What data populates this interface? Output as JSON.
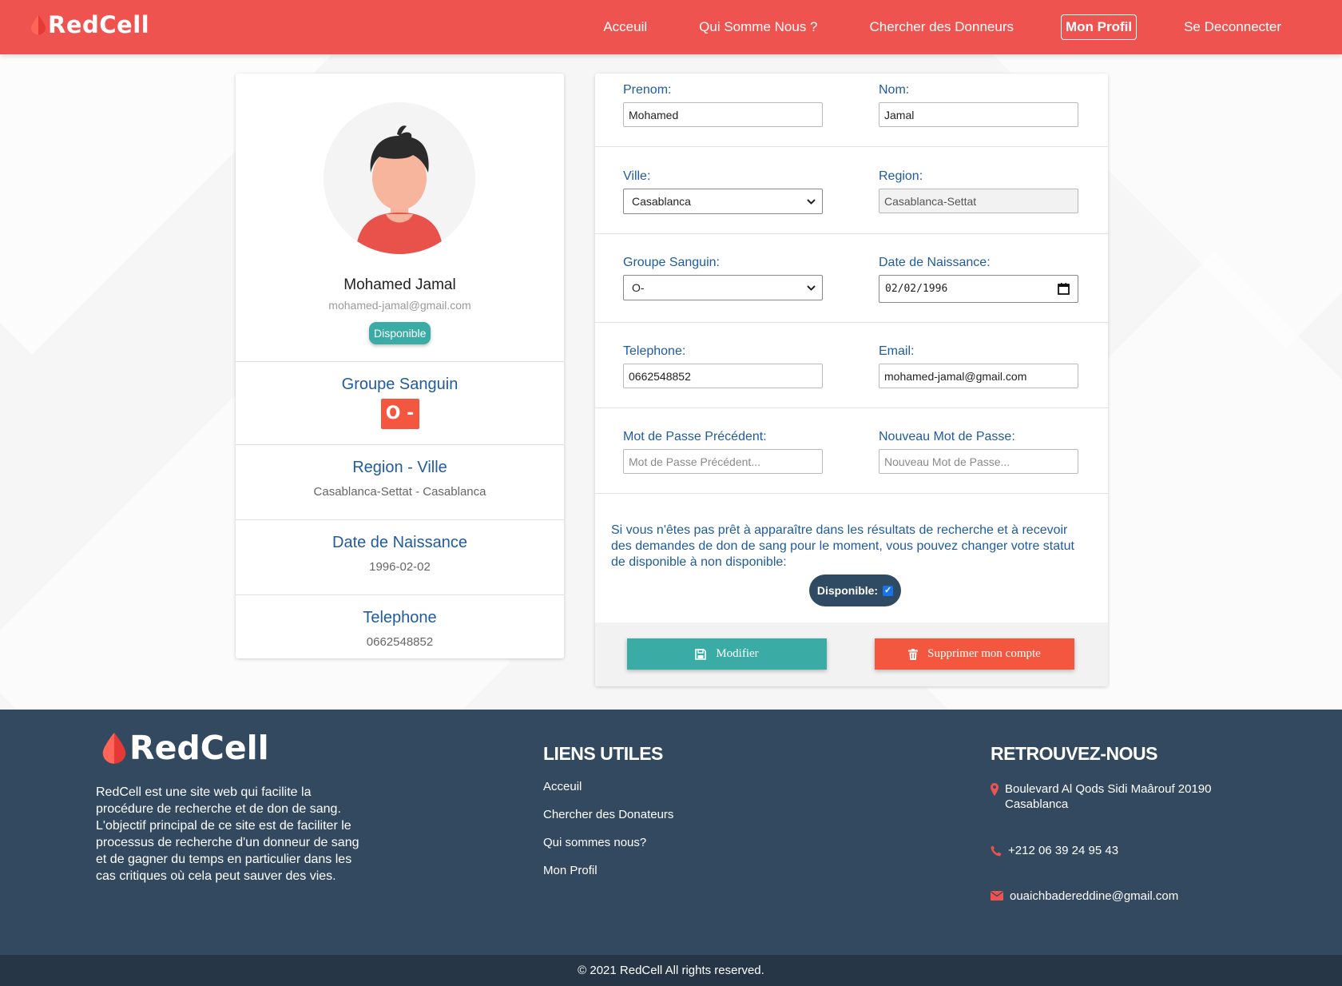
{
  "navbar": {
    "brand": "RedCell",
    "links": [
      "Acceuil",
      "Qui Somme Nous ?",
      "Chercher des Donneurs",
      "Mon Profil",
      "Se Deconnecter"
    ]
  },
  "profile": {
    "name": "Mohamed Jamal",
    "email": "mohamed-jamal@gmail.com",
    "status_badge": "Disponible",
    "blood_title": "Groupe Sanguin",
    "blood_value": "O -",
    "region_title": "Region - Ville",
    "region_value": "Casablanca-Settat - Casablanca",
    "birth_title": "Date de Naissance",
    "birth_value": "1996-02-02",
    "phone_title": "Telephone",
    "phone_value": "0662548852"
  },
  "form": {
    "prenom_label": "Prenom:",
    "prenom_value": "Mohamed",
    "nom_label": "Nom:",
    "nom_value": "Jamal",
    "ville_label": "Ville:",
    "ville_value": "Casablanca",
    "region_label": "Region:",
    "region_value": "Casablanca-Settat",
    "groupe_label": "Groupe Sanguin:",
    "groupe_value": "O-",
    "date_label": "Date de Naissance:",
    "date_value": "02/02/1996",
    "tel_label": "Telephone:",
    "tel_value": "0662548852",
    "email_label": "Email:",
    "email_value": "mohamed-jamal@gmail.com",
    "oldpass_label": "Mot de Passe Précédent:",
    "oldpass_placeholder": "Mot de Passe Précédent...",
    "newpass_label": "Nouveau Mot de Passe:",
    "newpass_placeholder": "Nouveau Mot de Passe...",
    "info_text": "Si vous n'êtes pas prêt à apparaître dans les résultats de recherche et à recevoir des demandes de don de sang pour le moment, vous pouvez changer votre statut de disponible à non disponible:",
    "toggle_label": "Disponible:",
    "toggle_checked": true,
    "modify_button": "Modifier",
    "delete_button": "Supprimer mon compte"
  },
  "footer": {
    "brand": "RedCell",
    "description": "RedCell est une site web qui facilite la procédure de recherche et de don de sang. L'objectif principal de ce site est de faciliter le processus de recherche d'un donneur de sang et de gagner du temps en particulier dans les cas critiques où cela peut sauver des vies.",
    "links_title": "LIENS UTILES",
    "links": [
      "Acceuil",
      "Chercher des Donateurs",
      "Qui sommes nous?",
      "Mon Profil"
    ],
    "contact_title": "RETROUVEZ-NOUS",
    "address": "Boulevard Al Qods Sidi Maârouf 20190 Casablanca",
    "phone": "+212 06 39 24 95 43",
    "email": "ouaichbadereddine@gmail.com",
    "copyright": "© 2021 RedCell All rights reserved."
  },
  "colors": {
    "brand_red": "#ef5350",
    "teal": "#3aaba5",
    "orange_red": "#f4573f",
    "navy": "#33495f",
    "label_blue": "#1f5b9d"
  },
  "icons": [
    "blood-drop-icon",
    "save-icon",
    "trash-icon",
    "map-pin-icon",
    "phone-icon",
    "mail-icon",
    "calendar-icon",
    "chevron-down-icon",
    "checkbox-icon"
  ]
}
